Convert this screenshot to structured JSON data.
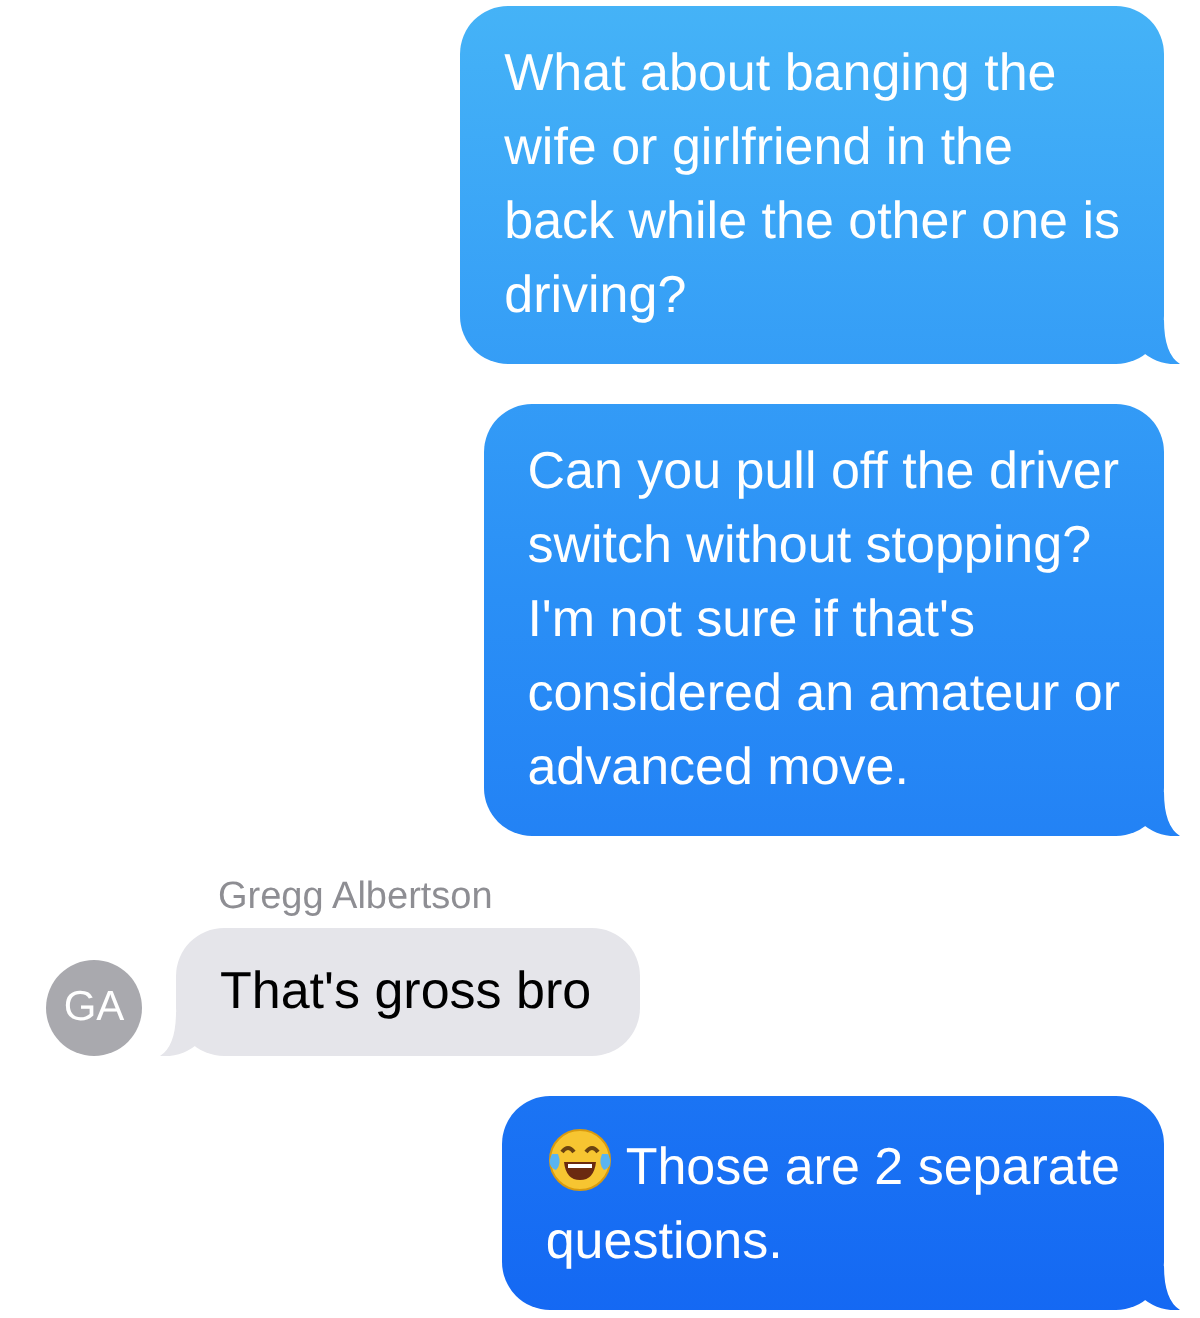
{
  "messages": [
    {
      "kind": "sent",
      "text": "What about banging the\nwife or girlfriend in the\nback while the other one is\ndriving?"
    },
    {
      "kind": "sent",
      "text": "Can you pull off the driver\nswitch without stopping?\nI'm not sure if that's\nconsidered an amateur or\nadvanced move."
    },
    {
      "kind": "received",
      "sender": "Gregg Albertson",
      "avatar": "GA",
      "text": "That's gross bro"
    },
    {
      "kind": "sent",
      "leading_icon": true,
      "text": "Those are 2 separate\nquestions."
    }
  ]
}
